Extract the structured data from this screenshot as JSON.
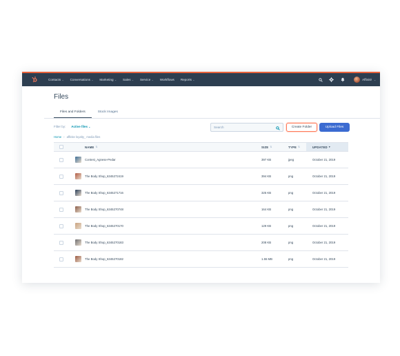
{
  "nav": {
    "items": [
      {
        "label": "Contacts"
      },
      {
        "label": "Conversations"
      },
      {
        "label": "Marketing"
      },
      {
        "label": "Sales"
      },
      {
        "label": "Service"
      },
      {
        "label": "Workflows"
      },
      {
        "label": "Reports"
      }
    ],
    "account_name": "Affinité"
  },
  "page": {
    "title": "Files",
    "tabs": [
      {
        "label": "Files and Folders",
        "active": true
      },
      {
        "label": "Stock Images",
        "active": false
      }
    ]
  },
  "toolbar": {
    "filter_label": "Filter by:",
    "filter_value": "Active files",
    "search_placeholder": "Search",
    "create_folder_label": "Create Folder",
    "upload_label": "Upload Files"
  },
  "breadcrumb": {
    "home": "Home",
    "separator": "›",
    "current": "affinite loyalty_ media files"
  },
  "table": {
    "headers": {
      "name": "NAME",
      "size": "SIZE",
      "type": "TYPE",
      "updated": "UPDATED"
    },
    "rows": [
      {
        "name": "Contest_Agnese-Pedar",
        "size": "397 KB",
        "type": "jpeg",
        "updated": "October 21, 2019",
        "thumb_color": "#3d6e96"
      },
      {
        "name": "The Body Shop_6345272419",
        "size": "394 KB",
        "type": "png",
        "updated": "October 21, 2019",
        "thumb_color": "#b25d45"
      },
      {
        "name": "The Body Shop_6345271716",
        "size": "325 KB",
        "type": "png",
        "updated": "October 21, 2019",
        "thumb_color": "#2a3f5a"
      },
      {
        "name": "The Body Shop_6345270748",
        "size": "164 KB",
        "type": "png",
        "updated": "October 21, 2019",
        "thumb_color": "#8a5d4a"
      },
      {
        "name": "The Body Shop_6345270170",
        "size": "129 KB",
        "type": "png",
        "updated": "October 21, 2019",
        "thumb_color": "#c9a27f"
      },
      {
        "name": "The Body Shop_6345270183",
        "size": "208 KB",
        "type": "png",
        "updated": "October 21, 2019",
        "thumb_color": "#6f6f72"
      },
      {
        "name": "The Body Shop_6345270182",
        "size": "1.55 MB",
        "type": "png",
        "updated": "October 21, 2019",
        "thumb_color": "#9b5a42"
      }
    ]
  },
  "icons": {
    "logo": "hubspot-sprocket-icon",
    "search": "search-icon",
    "settings": "gear-icon",
    "notifications": "bell-icon"
  },
  "colors": {
    "nav_bg": "#2d3e50",
    "accent": "#ff7a59",
    "primary_button": "#3b6bd1",
    "link": "#0091ae"
  }
}
